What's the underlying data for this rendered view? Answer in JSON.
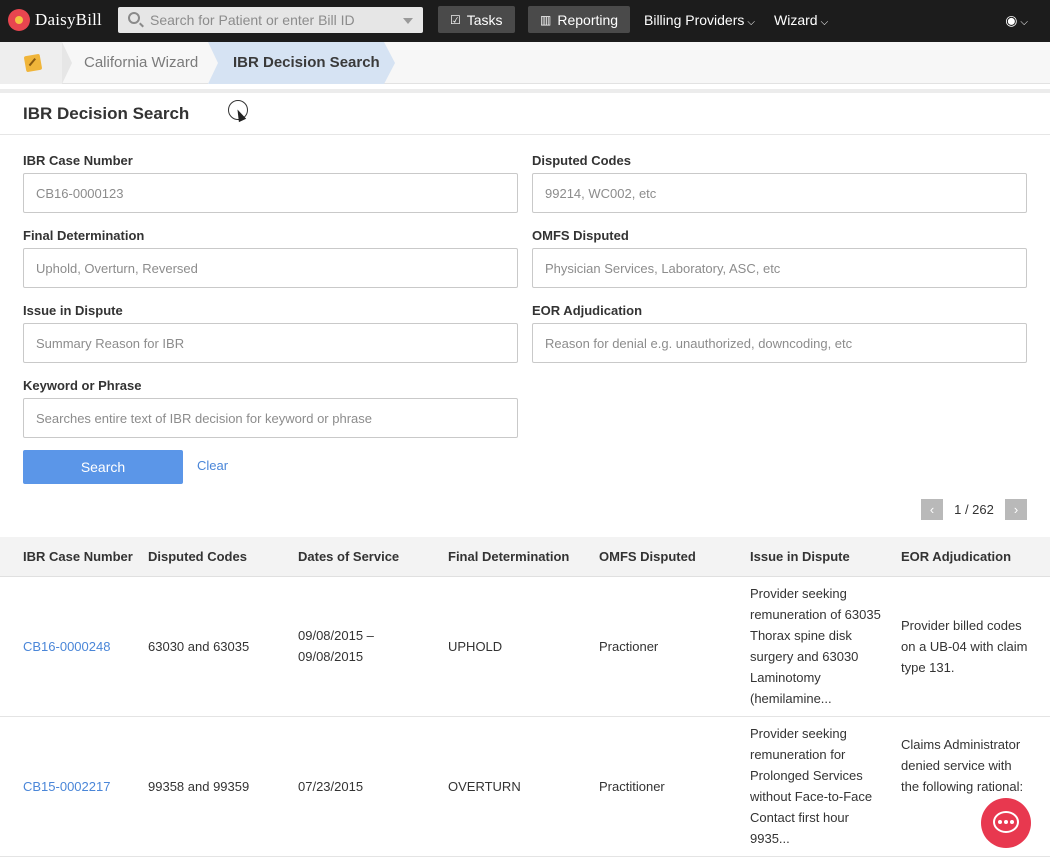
{
  "nav": {
    "brand": "DaisyBill",
    "search_placeholder": "Search for Patient or enter Bill ID",
    "tasks": "Tasks",
    "reporting": "Reporting",
    "billing_providers": "Billing Providers",
    "wizard": "Wizard",
    "chevron": "⌵",
    "user_icon": "user-circle-icon"
  },
  "breadcrumb": {
    "item1": "California Wizard",
    "item2": "IBR Decision Search"
  },
  "page": {
    "title": "IBR Decision Search"
  },
  "form": {
    "case_number": {
      "label": "IBR Case Number",
      "placeholder": "CB16-0000123"
    },
    "disputed_codes": {
      "label": "Disputed Codes",
      "placeholder": "99214, WC002, etc"
    },
    "final_determination": {
      "label": "Final Determination",
      "placeholder": "Uphold, Overturn, Reversed"
    },
    "omfs_disputed": {
      "label": "OMFS Disputed",
      "placeholder": "Physician Services, Laboratory, ASC, etc"
    },
    "issue_in_dispute": {
      "label": "Issue in Dispute",
      "placeholder": "Summary Reason for IBR"
    },
    "eor_adjudication": {
      "label": "EOR Adjudication",
      "placeholder": "Reason for denial e.g. unauthorized, downcoding, etc"
    },
    "keyword": {
      "label": "Keyword or Phrase",
      "placeholder": "Searches entire text of IBR decision for keyword or phrase"
    },
    "search_button": "Search",
    "clear_link": "Clear"
  },
  "pager": {
    "prev": "‹",
    "next": "›",
    "text": "1 / 262"
  },
  "table": {
    "headers": [
      "IBR Case Number",
      "Disputed Codes",
      "Dates of Service",
      "Final Determination",
      "OMFS Disputed",
      "Issue in Dispute",
      "EOR Adjudication"
    ],
    "rows": [
      {
        "case": "CB16-0000248",
        "codes": "63030 and 63035",
        "dates": "09/08/2015 – 09/08/2015",
        "determination": "UPHOLD",
        "omfs": "Practioner",
        "issue": "Provider seeking remuneration of 63035 Thorax spine disk surgery and 63030 Laminotomy (hemilamine...",
        "eor": "Provider billed codes on a UB-04 with claim type 131."
      },
      {
        "case": "CB15-0002217",
        "codes": "99358 and 99359",
        "dates": "07/23/2015",
        "determination": "OVERTURN",
        "omfs": "Practitioner",
        "issue": "Provider seeking remuneration for Prolonged Services without Face-to-Face Contact first hour 9935...",
        "eor": "Claims Administrator denied service with the following rational:"
      }
    ]
  }
}
